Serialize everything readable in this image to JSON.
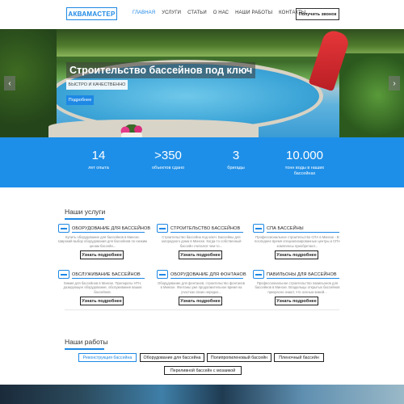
{
  "header": {
    "logo": "АКВАМАСТЕР",
    "nav": [
      "ГЛАВНАЯ",
      "УСЛУГИ",
      "СТАТЬИ",
      "О НАС",
      "НАШИ РАБОТЫ",
      "КОНТАКТЫ"
    ],
    "call_button": "Получить звонок"
  },
  "hero": {
    "title": "Строительство бассейнов под ключ",
    "subtitle": "БЫСТРО И КАЧЕСТВЕННО",
    "button": "Подробнее",
    "prev_arrow": "‹",
    "next_arrow": "›"
  },
  "stats": [
    {
      "value": "14",
      "label": "лет опыта"
    },
    {
      "value": ">350",
      "label": "объектов сдано"
    },
    {
      "value": "3",
      "label": "бригады"
    },
    {
      "value": "10.000",
      "label": "тонн воды в наших бассейнах"
    }
  ],
  "services": {
    "title": "Наши услуги",
    "items": [
      {
        "name": "ОБОРУДОВАНИЕ ДЛЯ БАССЕЙНОВ",
        "desc": "Купить оборудование для бассейнов в Минске. Широкий выбор оборудования для бассейнов по низким ценам бассейн...",
        "button": "Узнать подробнее"
      },
      {
        "name": "СТРОИТЕЛЬСТВО БАССЕЙНОВ",
        "desc": "Строительство бассейна под ключ. Бассейны для загородного дома в Минске. Когда-то собственный бассейн считался чем-то...",
        "button": "Узнать подробнее"
      },
      {
        "name": "СПА БАССЕЙНЫ",
        "desc": "Профессиональное строительство СПА в Минске - В последнее время специализированные центры и СПА комплексы приобретают...",
        "button": "Узнать подробнее"
      },
      {
        "name": "ОБСЛУЖИВАНИЕ БАССЕЙНОВ",
        "desc": "Химия для бассейнов в Минске. Препараты HTH, дозирующее оборудование, обслуживание ваших бассейнов.",
        "button": "Узнать подробнее"
      },
      {
        "name": "ОБОРУДОВАНИЕ ДЛЯ ФОНТАНОВ",
        "desc": "Оборудование для фонтанов, строительство фонтанов в Минске. Фонтаны уже продолжительное время на участках своих нередко...",
        "button": "Узнать подробнее"
      },
      {
        "name": "ПАВИЛЬОНЫ ДЛЯ БАССЕЙНОВ",
        "desc": "Профессиональное строительство павильонов для бассейнов в Минске. Владельцы открытых бассейнов прекрасно знают, что осенью-зимой...",
        "button": "Узнать подробнее"
      }
    ]
  },
  "works": {
    "title": "Наши работы",
    "filters": [
      "Реконструкция бассейна",
      "Оборудование для бассейна",
      "Полипропиленовый бассейн",
      "Пленочный бассейн",
      "Переливной бассейн с мозаикой"
    ]
  },
  "colors": {
    "accent": "#1e88e5",
    "stats_bg": "#1e8fe8"
  }
}
